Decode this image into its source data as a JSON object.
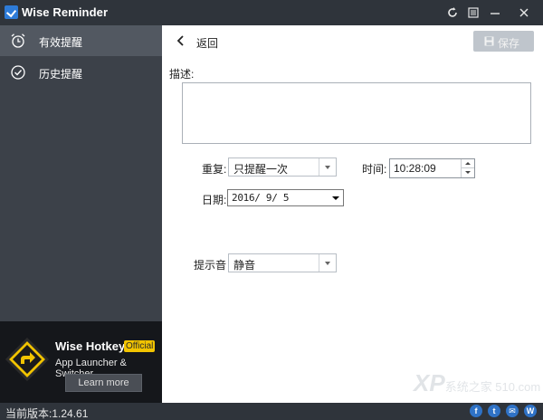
{
  "window": {
    "title": "Wise Reminder",
    "controls": [
      "refresh-icon",
      "menu-icon",
      "minimize-icon",
      "close-icon"
    ]
  },
  "sidebar": {
    "items": [
      {
        "label": "有效提醒",
        "icon": "alarm-clock-icon",
        "active": true
      },
      {
        "label": "历史提醒",
        "icon": "check-circle-icon",
        "active": false
      }
    ]
  },
  "ad": {
    "title": "Wise Hotkey",
    "badge": "Official",
    "subtitle": "App Launcher & Switcher",
    "button": "Learn more"
  },
  "main": {
    "back_label": "返回",
    "save_label": "保存",
    "description_label": "描述:",
    "description_value": "",
    "repeat_label": "重复:",
    "repeat_value": "只提醒一次",
    "time_label": "时间:",
    "time_value": "10:28:09",
    "date_label": "日期:",
    "date_value": "2016/ 9/ 5",
    "sound_label": "提示音",
    "sound_value": "静音"
  },
  "status": {
    "version": "当前版本:1.24.61",
    "social": [
      "facebook-icon",
      "twitter-icon",
      "mail-icon",
      "wise-icon"
    ]
  },
  "watermark": {
    "text": "XP",
    "sub": "系统之家 510.com"
  },
  "colors": {
    "sidebar_bg": "#3c4149",
    "active_item": "#525861",
    "titlebar": "#2f343b",
    "accent": "#f2c400",
    "save_disabled": "#bfc5cc"
  }
}
